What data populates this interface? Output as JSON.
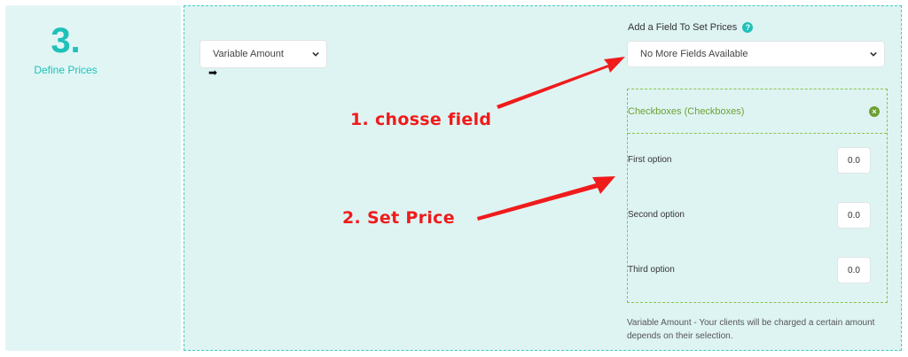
{
  "step": {
    "number": "3.",
    "label": "Define Prices"
  },
  "pricing_type": {
    "selected": "Variable Amount"
  },
  "add_field": {
    "label": "Add a Field To Set Prices",
    "selected": "No More Fields Available"
  },
  "checkbox_group": {
    "title": "Checkboxes (Checkboxes)",
    "options": [
      {
        "label": "First option",
        "price": "0.0"
      },
      {
        "label": "Second option",
        "price": "0.0"
      },
      {
        "label": "Third option",
        "price": "0.0"
      }
    ]
  },
  "help_text": "Variable Amount - Your clients will be charged a certain amount depends on their selection.",
  "annotations": {
    "step1": "1. chosse field",
    "step2": "2. Set Price"
  },
  "colors": {
    "accent": "#1fc1b9",
    "panel_bg": "#def4f3",
    "group_border": "#8bc34a",
    "annotation_red": "#f01b1b"
  },
  "icons": {
    "help": "help-icon",
    "remove": "remove-circle-icon",
    "chevron": "chevron-down-icon",
    "drag_arrow": "arrow-right-icon"
  }
}
